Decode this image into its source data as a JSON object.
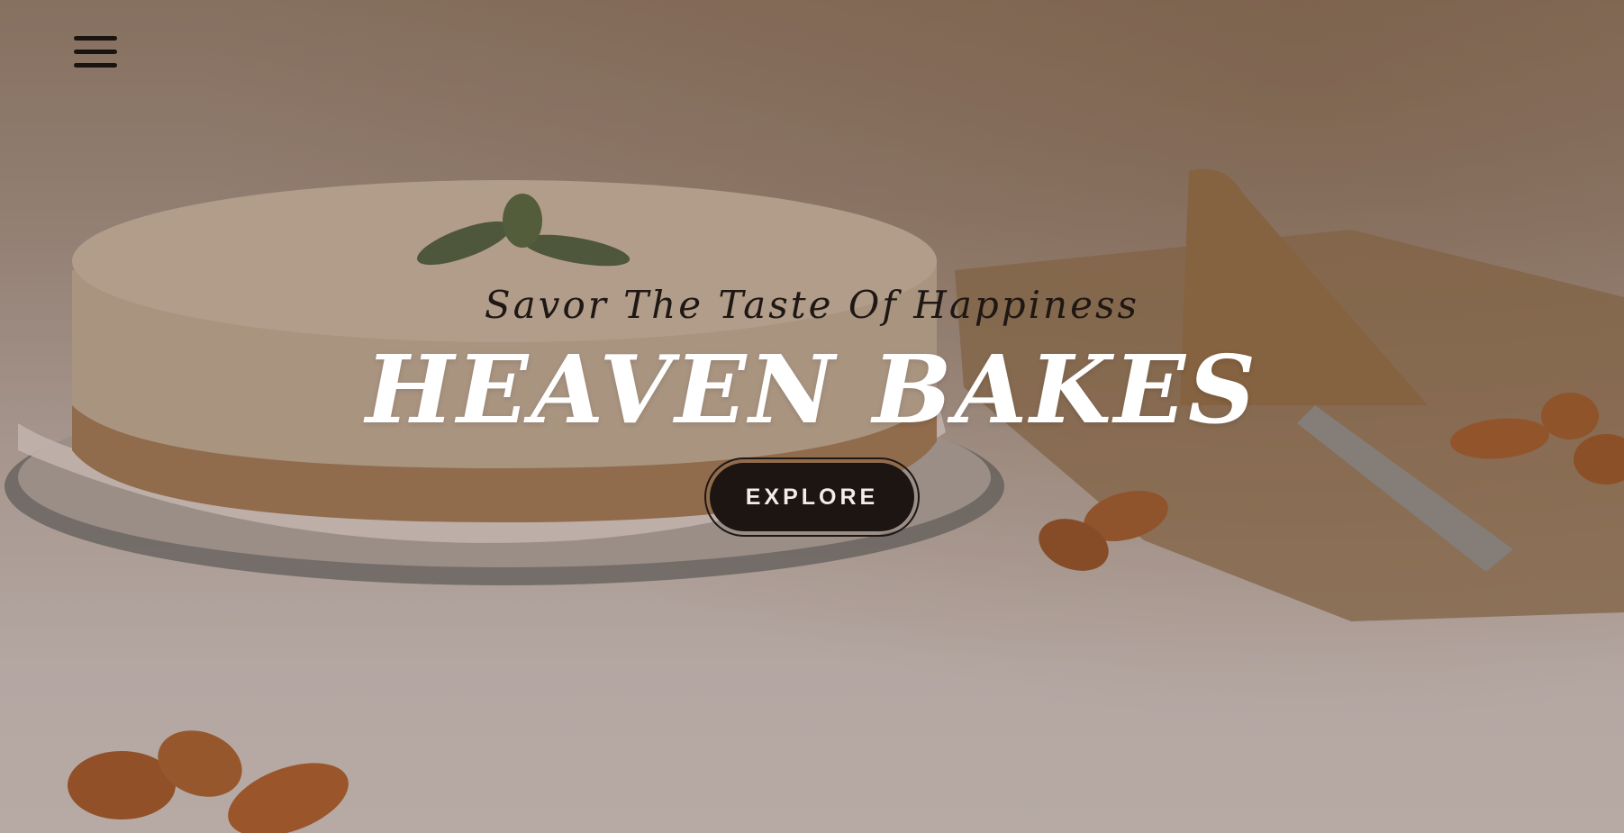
{
  "nav": {
    "menu_icon": "hamburger-menu-icon"
  },
  "hero": {
    "tagline": "Savor The Taste Of Happiness",
    "title": "HEAVEN BAKES",
    "explore_label": "EXPLORE",
    "background_image": "cheesecake-with-mint-almonds-and-cake-server"
  },
  "colors": {
    "title": "#ffffff",
    "tagline": "#1e1714",
    "button_bg": "#1d1512",
    "button_text": "#f4ece6"
  }
}
